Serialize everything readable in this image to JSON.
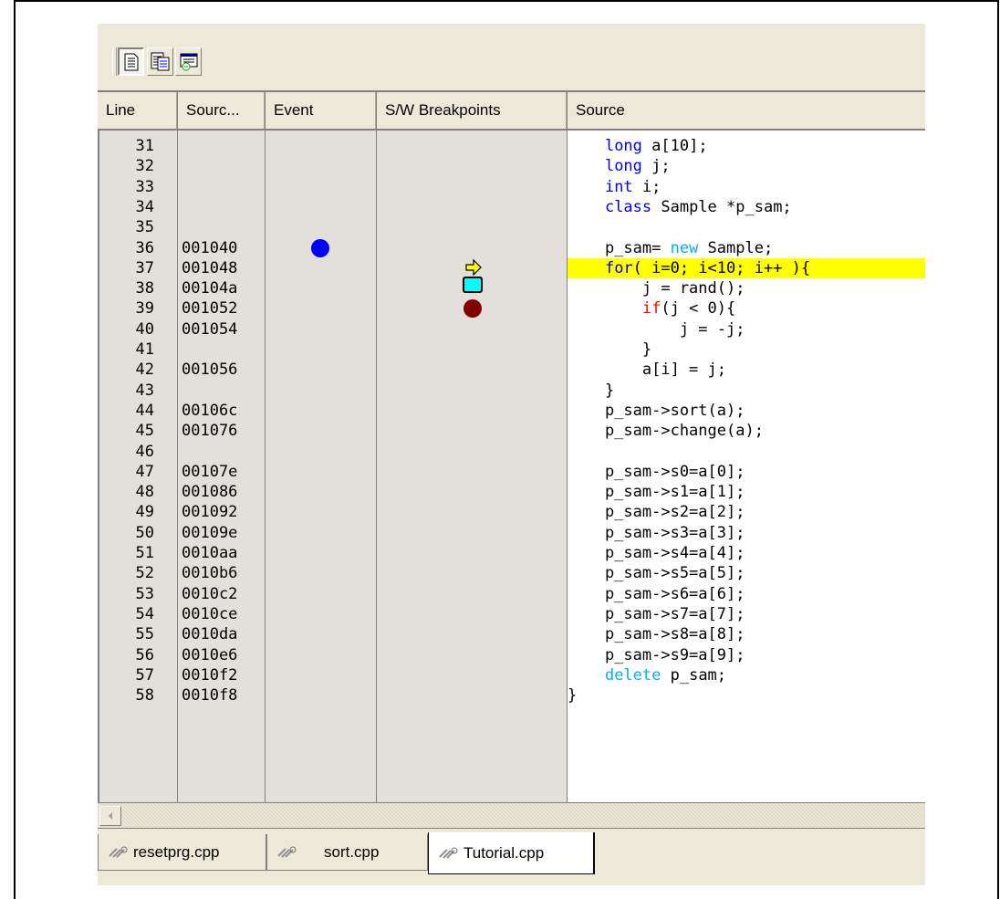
{
  "toolbar": {
    "buttons": [
      {
        "icon": "source-view-icon"
      },
      {
        "icon": "mixed-view-icon"
      },
      {
        "icon": "disassembly-view-icon"
      }
    ]
  },
  "columns": [
    "Line",
    "Sourc...",
    "Event",
    "S/W Breakpoints",
    "Source"
  ],
  "rows": [
    {
      "line": "31",
      "addr": "",
      "src": "    long a[10];"
    },
    {
      "line": "32",
      "addr": "",
      "src": "    long j;"
    },
    {
      "line": "33",
      "addr": "",
      "src": "    int i;"
    },
    {
      "line": "34",
      "addr": "",
      "src": "    class Sample *p_sam;"
    },
    {
      "line": "35",
      "addr": "",
      "src": ""
    },
    {
      "line": "36",
      "addr": "001040",
      "src": "    p_sam= new Sample;"
    },
    {
      "line": "37",
      "addr": "001048",
      "src": "    for( i=0; i<10; i++ ){"
    },
    {
      "line": "38",
      "addr": "00104a",
      "src": "        j = rand();"
    },
    {
      "line": "39",
      "addr": "001052",
      "src": "        if(j < 0){"
    },
    {
      "line": "40",
      "addr": "001054",
      "src": "            j = -j;"
    },
    {
      "line": "41",
      "addr": "",
      "src": "        }"
    },
    {
      "line": "42",
      "addr": "001056",
      "src": "        a[i] = j;"
    },
    {
      "line": "43",
      "addr": "",
      "src": "    }"
    },
    {
      "line": "44",
      "addr": "00106c",
      "src": "    p_sam->sort(a);"
    },
    {
      "line": "45",
      "addr": "001076",
      "src": "    p_sam->change(a);"
    },
    {
      "line": "46",
      "addr": "",
      "src": ""
    },
    {
      "line": "47",
      "addr": "00107e",
      "src": "    p_sam->s0=a[0];"
    },
    {
      "line": "48",
      "addr": "001086",
      "src": "    p_sam->s1=a[1];"
    },
    {
      "line": "49",
      "addr": "001092",
      "src": "    p_sam->s2=a[2];"
    },
    {
      "line": "50",
      "addr": "00109e",
      "src": "    p_sam->s3=a[3];"
    },
    {
      "line": "51",
      "addr": "0010aa",
      "src": "    p_sam->s4=a[4];"
    },
    {
      "line": "52",
      "addr": "0010b6",
      "src": "    p_sam->s5=a[5];"
    },
    {
      "line": "53",
      "addr": "0010c2",
      "src": "    p_sam->s6=a[6];"
    },
    {
      "line": "54",
      "addr": "0010ce",
      "src": "    p_sam->s7=a[7];"
    },
    {
      "line": "55",
      "addr": "0010da",
      "src": "    p_sam->s8=a[8];"
    },
    {
      "line": "56",
      "addr": "0010e6",
      "src": "    p_sam->s9=a[9];"
    },
    {
      "line": "57",
      "addr": "0010f2",
      "src": "    delete p_sam;"
    },
    {
      "line": "58",
      "addr": "0010f8",
      "src": "}"
    }
  ],
  "highlight_line": "37",
  "markers": {
    "event_line": "36",
    "pc_line": "37",
    "bookmark_line": "38",
    "breakpoint_line": "39"
  },
  "colors": {
    "keyword_blue": "#0000ff",
    "keyword_cyan": "#00b0ff",
    "keyword_red": "#ff0000",
    "highlight": "#ffff00",
    "event_marker": "#0000ff",
    "breakpoint_marker": "#800000",
    "bookmark_marker": "#00ffff",
    "pc_arrow": "#ffff00"
  },
  "tabs": [
    {
      "label": "resetprg.cpp",
      "icon": "file-tab-icon",
      "active": false
    },
    {
      "label": "sort.cpp",
      "icon": "file-tab-icon",
      "active": false
    },
    {
      "label": "Tutorial.cpp",
      "icon": "file-tab-icon",
      "active": true
    }
  ]
}
